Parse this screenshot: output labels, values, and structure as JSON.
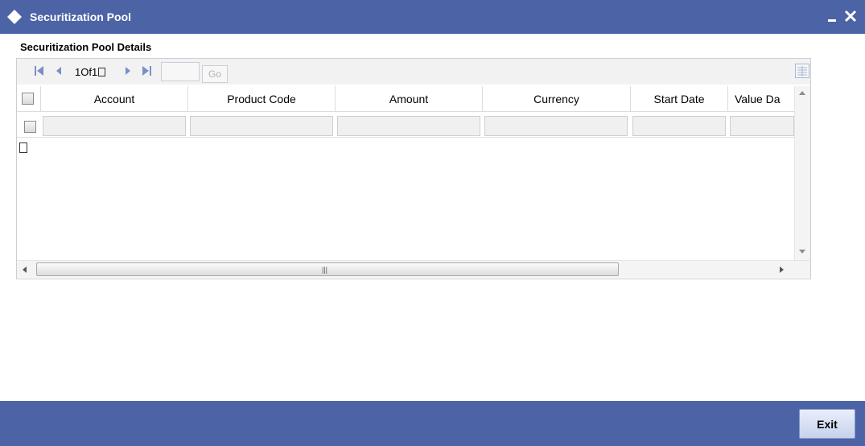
{
  "window": {
    "title": "Securitization Pool",
    "title_bar_color": "#4c63a6"
  },
  "section": {
    "label": "Securitization Pool Details"
  },
  "pager": {
    "text": "1Of1",
    "page_input_value": "",
    "go_label": "Go"
  },
  "table": {
    "columns": [
      "Account",
      "Product Code",
      "Amount",
      "Currency",
      "Start Date",
      "Value Da"
    ]
  },
  "footer": {
    "exit_label": "Exit",
    "footer_color": "#4c63a6"
  }
}
